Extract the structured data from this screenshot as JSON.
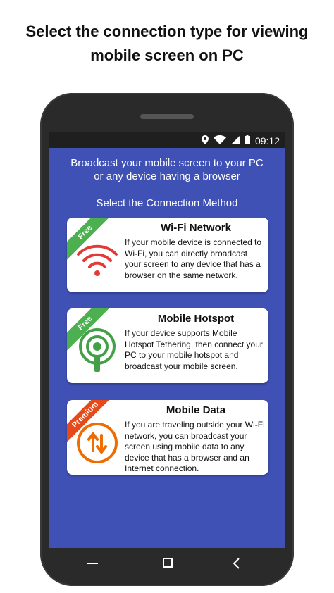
{
  "headline": {
    "line1": "Select the connection type for viewing",
    "line2": "mobile screen on PC"
  },
  "status_bar": {
    "time": "09:12",
    "icons": [
      "location-icon",
      "wifi-icon",
      "signal-icon",
      "battery-icon"
    ]
  },
  "intro": {
    "line1": "Broadcast your mobile screen to your PC",
    "line2": "or any device having a browser"
  },
  "section_title": "Select the Connection Method",
  "cards": [
    {
      "badge": "Free",
      "title": "Wi-Fi Network",
      "description": "If your mobile device is connected to Wi-Fi, you can directly broadcast your screen to any device that has a browser on the same network.",
      "icon": "wifi-icon",
      "color": "#e53935"
    },
    {
      "badge": "Free",
      "title": "Mobile Hotspot",
      "description": "If your device supports Mobile Hotspot Tethering, then connect your PC to your mobile hotspot and broadcast your mobile screen.",
      "icon": "hotspot-icon",
      "color": "#43a047"
    },
    {
      "badge": "Premium",
      "title": "Mobile Data",
      "description": "If you are traveling outside your Wi-Fi network, you can broadcast your screen using mobile data to any device that has a browser and an Internet connection.",
      "icon": "data-transfer-icon",
      "color": "#ef6c00"
    }
  ],
  "colors": {
    "screen_background": "#3f51b5",
    "free_badge": "#4caf50",
    "premium_badge": "#e64a19"
  },
  "nav_bar": {
    "buttons": [
      "recents-button",
      "home-button",
      "back-button"
    ]
  }
}
